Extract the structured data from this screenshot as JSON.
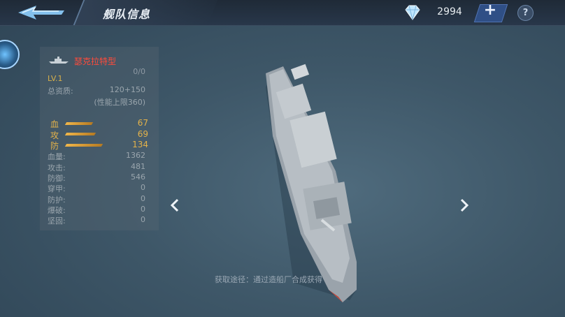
{
  "header": {
    "title": "舰队信息",
    "currency": {
      "icon": "diamond-icon",
      "amount": "2994"
    },
    "add_label": "+",
    "help_label": "?"
  },
  "ship": {
    "name": "瑟克拉特型",
    "exp": "0/0",
    "level": "LV.1",
    "quality_label": "总资质:",
    "quality_value": "120+150",
    "quality_cap": "(性能上限360)",
    "core_stats": [
      {
        "label": "血",
        "value": "67",
        "level": 0.67
      },
      {
        "label": "攻",
        "value": "69",
        "level": 0.69
      },
      {
        "label": "防",
        "value": "134",
        "level": 0.95
      }
    ],
    "attributes": [
      {
        "label": "血量:",
        "value": "1362"
      },
      {
        "label": "攻击:",
        "value": "481"
      },
      {
        "label": "防御:",
        "value": "546"
      },
      {
        "label": "穿甲:",
        "value": "0"
      },
      {
        "label": "防护:",
        "value": "0"
      },
      {
        "label": "爆破:",
        "value": "0"
      },
      {
        "label": "坚固:",
        "value": "0"
      }
    ]
  },
  "acquire_text": "获取途径：通过造船厂合成获得"
}
